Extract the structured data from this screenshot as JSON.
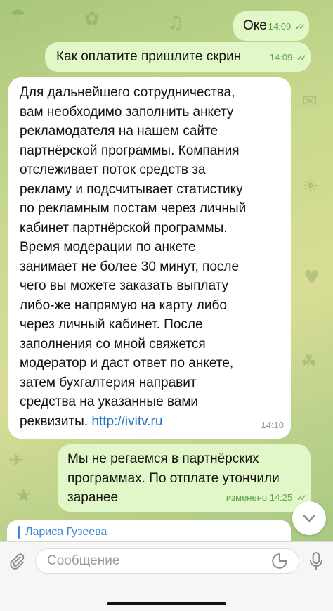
{
  "messages": [
    {
      "direction": "out",
      "text": "Оке",
      "time": "14:09",
      "status": "read-icon"
    },
    {
      "direction": "out",
      "text": "Как оплатите пришлите скрин",
      "time": "14:09",
      "status": "read-icon"
    },
    {
      "direction": "in",
      "lines": [
        "Для дальнейшего сотрудничества,",
        "вам необходимо заполнить анкету",
        "рекламодателя на нашем сайте",
        "партнёрской программы. Компания",
        "отслеживает поток средств за",
        "рекламу и подсчитывает статистику",
        "по рекламным постам через личный",
        "кабинет партнёрской программы.",
        "Время модерации по анкете",
        "занимает не более 30 минут, после",
        "чего вы можете заказать выплату",
        "либо-же напрямую на карту либо",
        "через личный кабинет. После",
        "заполнения со мной свяжется",
        "модератор и даст ответ по анкете,",
        "затем бухгалтерия направит",
        "средства на указанные вами"
      ],
      "last_line_text": "реквизиты.",
      "link": "http://ivitv.ru",
      "time": "14:10"
    },
    {
      "direction": "out",
      "lines": [
        "Мы не регаемся в партнёрских",
        "программах. По отплате утончили",
        "заранее"
      ],
      "time": "изменено 14:25",
      "status": "read-icon"
    }
  ],
  "reply_preview": {
    "name": "Лариса Гузеева"
  },
  "composer": {
    "placeholder": "Сообщение",
    "value": ""
  },
  "icons": {
    "attach": "paperclip-icon",
    "sticker": "sticker-icon",
    "voice": "microphone-icon",
    "scroll": "chevron-down-icon"
  },
  "colors": {
    "outgoing_bubble": "#e2f7c8",
    "incoming_bubble": "#ffffff",
    "accent": "#3a88d8",
    "link": "#1f74c8",
    "checkmarks": "#5fa54a"
  }
}
